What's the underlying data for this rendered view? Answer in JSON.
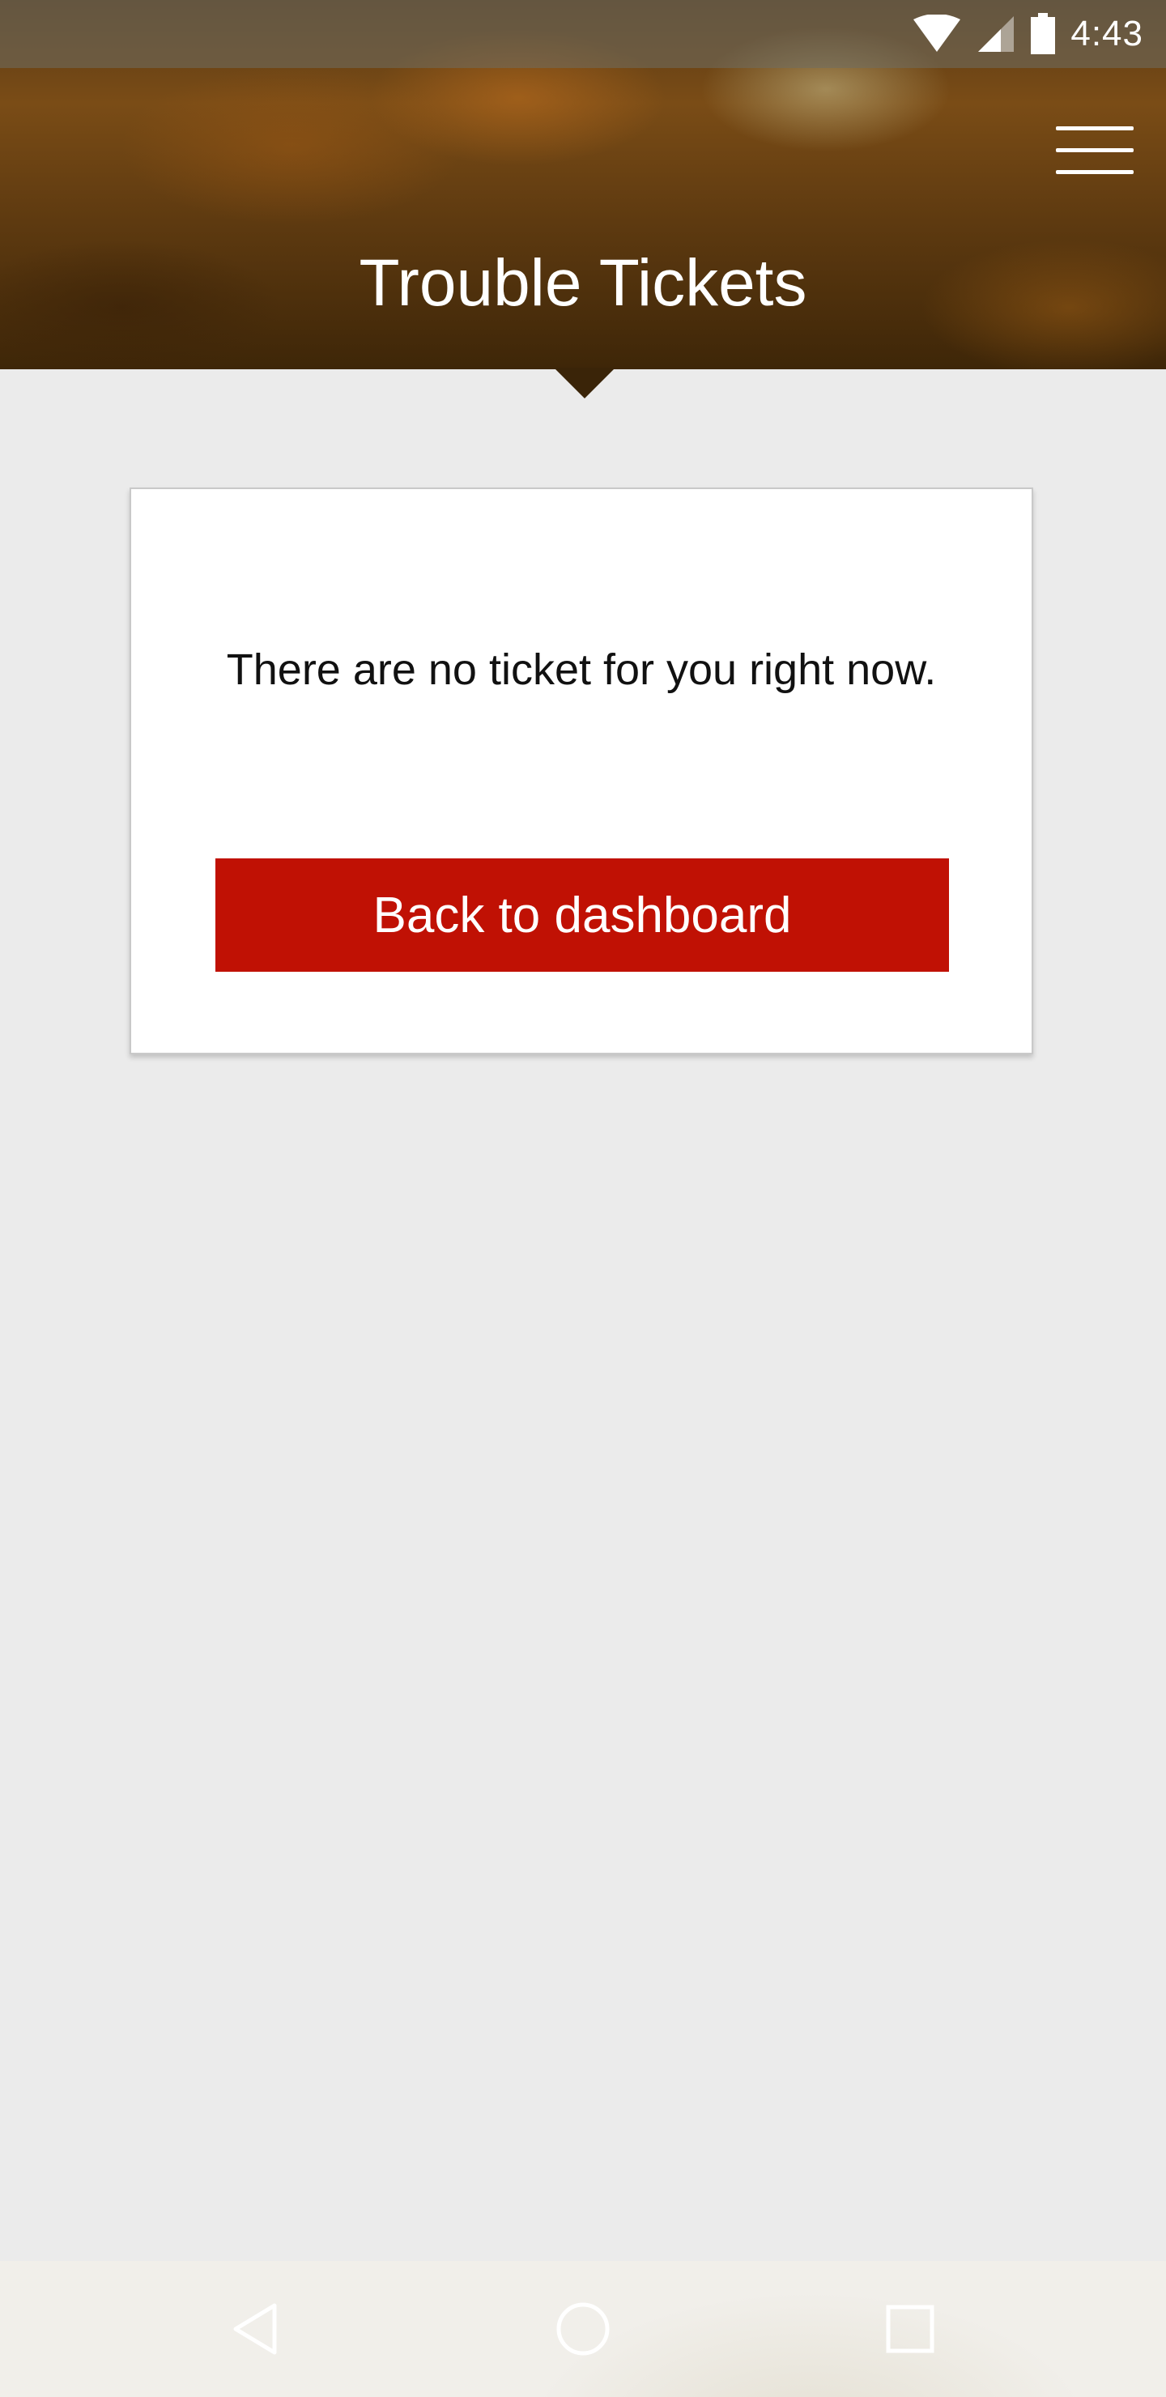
{
  "status_bar": {
    "time": "4:43",
    "icons": [
      "wifi-icon",
      "signal-icon",
      "battery-icon"
    ]
  },
  "header": {
    "title": "Trouble Tickets",
    "menu_icon": "hamburger-menu-icon"
  },
  "card": {
    "message": "There are no ticket for you right now.",
    "button_label": "Back to dashboard"
  },
  "nav_bar": {
    "icons": [
      "back-icon",
      "home-icon",
      "recents-icon"
    ]
  },
  "colors": {
    "accent": "#c01104",
    "background": "#ebebeb",
    "card": "#ffffff",
    "header_brown": "#5a3a14"
  }
}
